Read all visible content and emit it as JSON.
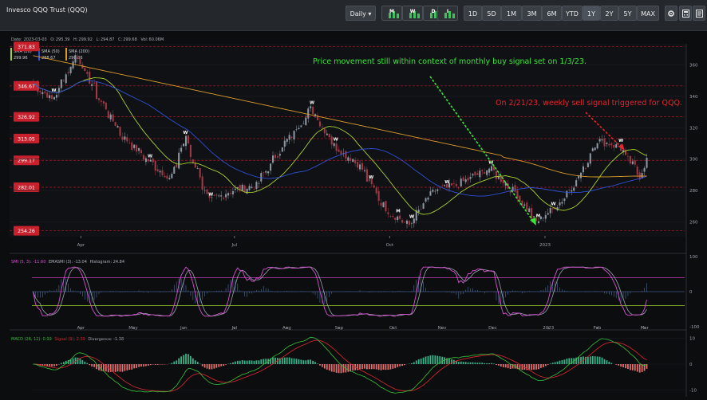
{
  "app": {
    "title": "Invesco QQQ Trust (QQQ)"
  },
  "toolbar": {
    "interval_label": "Daily",
    "chart_type_buttons": [
      {
        "label": "M",
        "icon": "monthly-candle-icon"
      },
      {
        "label": "W",
        "icon": "weekly-candle-icon"
      },
      {
        "label": "D",
        "icon": "daily-candle-icon"
      },
      {
        "label": "I",
        "icon": "intraday-candle-icon"
      }
    ],
    "ranges": [
      "1D",
      "5D",
      "1M",
      "3M",
      "6M",
      "YTD",
      "1Y",
      "2Y",
      "5Y",
      "MAX"
    ],
    "active_range": "1Y",
    "tool_icons": [
      "settings-icon",
      "calculator-icon",
      "notes-icon"
    ]
  },
  "info": {
    "date_label": "Date:",
    "date": "2023-03-03",
    "o_label": "O:",
    "o": "295.39",
    "h_label": "H:",
    "h": "299.92",
    "l_label": "L:",
    "l": "294.87",
    "c_label": "C:",
    "c": "299.68",
    "vol_label": "Vol:",
    "vol": "60.06M",
    "sma_labels": [
      "SMA (20)",
      "SMA (50)",
      "SMA (200)"
    ],
    "sma_values": [
      "299.96",
      "288.67",
      "290.06"
    ]
  },
  "annotations": {
    "buy_note": "Price movement still within context of monthly buy signal set on 1/3/23.",
    "sell_note": "On 2/21/23, weekly sell signal triggered for QQQ."
  },
  "colors": {
    "price_line": "#e33140",
    "buy_text": "#39e639",
    "sell_text": "#e8242e",
    "sma20": "#a7d22c",
    "sma50": "#2f4fd6",
    "sma200": "#d99a2b",
    "up": "#8d97a3",
    "down": "#a33845",
    "smi": "#d94fd3",
    "ema": "#9aa3ae",
    "macd": "#35c23a",
    "signal": "#e0262f",
    "hist_up": "#38b489",
    "hist_down": "#e36f6f",
    "upper_band": "#c33bb9",
    "lower_band": "#9bd22c"
  },
  "chart_data": [
    {
      "type": "candlestick",
      "title": "Invesco QQQ Trust (QQQ)",
      "x_tick_labels": [
        "Apr",
        "Jul",
        "Oct",
        "2023"
      ],
      "y_ticks": [
        260,
        280,
        300,
        320,
        340,
        360
      ],
      "ylim": [
        251,
        373
      ],
      "horizontal_levels": [
        371.83,
        346.67,
        326.92,
        313.05,
        299.17,
        282.01,
        254.26
      ],
      "close_approx": [
        {
          "date": "2022-03-03",
          "close": 348
        },
        {
          "date": "2022-03-15",
          "close": 338
        },
        {
          "date": "2022-03-29",
          "close": 366
        },
        {
          "date": "2022-04-12",
          "close": 338
        },
        {
          "date": "2022-04-26",
          "close": 314
        },
        {
          "date": "2022-05-10",
          "close": 300
        },
        {
          "date": "2022-05-24",
          "close": 287
        },
        {
          "date": "2022-06-02",
          "close": 313
        },
        {
          "date": "2022-06-16",
          "close": 273
        },
        {
          "date": "2022-06-30",
          "close": 280
        },
        {
          "date": "2022-07-14",
          "close": 283
        },
        {
          "date": "2022-07-28",
          "close": 305
        },
        {
          "date": "2022-08-16",
          "close": 332
        },
        {
          "date": "2022-08-31",
          "close": 307
        },
        {
          "date": "2022-09-13",
          "close": 297
        },
        {
          "date": "2022-09-30",
          "close": 267
        },
        {
          "date": "2022-10-13",
          "close": 258
        },
        {
          "date": "2022-10-28",
          "close": 280
        },
        {
          "date": "2022-11-10",
          "close": 283
        },
        {
          "date": "2022-11-30",
          "close": 294
        },
        {
          "date": "2022-12-15",
          "close": 279
        },
        {
          "date": "2022-12-28",
          "close": 260
        },
        {
          "date": "2023-01-10",
          "close": 271
        },
        {
          "date": "2023-01-24",
          "close": 291
        },
        {
          "date": "2023-02-02",
          "close": 312
        },
        {
          "date": "2023-02-15",
          "close": 308
        },
        {
          "date": "2023-02-28",
          "close": 289
        },
        {
          "date": "2023-03-03",
          "close": 299.68
        }
      ],
      "series": [
        {
          "name": "SMA (20)",
          "last": 299.96
        },
        {
          "name": "SMA (50)",
          "last": 288.67
        },
        {
          "name": "SMA (200)",
          "last": 290.06
        }
      ],
      "signals": [
        "W",
        "W",
        "W",
        "W",
        "W",
        "W",
        "W",
        "M",
        "W",
        "W",
        "W",
        "M",
        "W",
        "W"
      ]
    },
    {
      "type": "line",
      "title": "SMI",
      "header_parts": [
        "SMI (5, 3): -11.60",
        "EMASMI (3): -13.04",
        "Histogram: 24.84"
      ],
      "x_tick_labels": [
        "Apr",
        "May",
        "Jun",
        "Jul",
        "Aug",
        "Sep",
        "Oct",
        "Nov",
        "Dec",
        "2023",
        "Feb",
        "Mar"
      ],
      "y_ticks": [
        100,
        0,
        -100
      ],
      "ylim": [
        -100,
        100
      ],
      "bands": [
        40,
        -40
      ]
    },
    {
      "type": "line",
      "title": "MACD",
      "header_parts": [
        "MACD (26, 12): 0.99",
        "Signal (9): 2.39",
        "Divergence: -1.38"
      ],
      "y_ticks": [
        10,
        0,
        -10
      ],
      "ylim": [
        -12,
        12
      ]
    }
  ]
}
